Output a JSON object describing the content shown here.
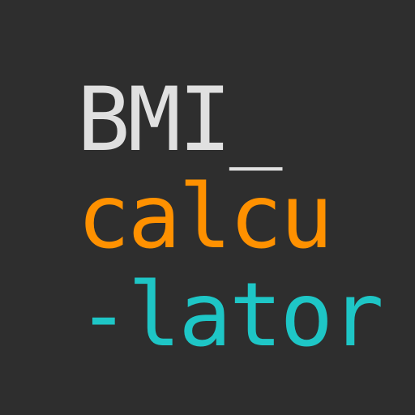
{
  "logo": {
    "line1": "BMI_",
    "line2": "calcu",
    "line3": "-lator"
  },
  "colors": {
    "background": "#2e2e2e",
    "line1": "#e0e0e0",
    "line2": "#ff9100",
    "line3": "#1ec6c6"
  }
}
